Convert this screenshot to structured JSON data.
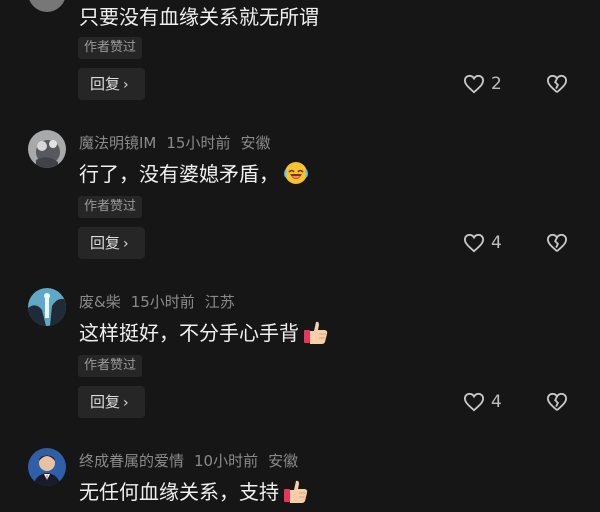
{
  "comments": [
    {
      "text": "只要没有血缘关系就无所谓",
      "author_liked": "作者赞过",
      "reply_label": "回复",
      "likes": "2"
    },
    {
      "username": "魔法明镜IM",
      "time": "15小时前",
      "location": "安徽",
      "text": "行了，没有婆媳矛盾，",
      "emoji": "laughing-face-emoji",
      "author_liked": "作者赞过",
      "reply_label": "回复",
      "likes": "4"
    },
    {
      "username": "废&柴",
      "time": "15小时前",
      "location": "江苏",
      "text": "这样挺好，不分手心手背",
      "emoji": "thumbs-up-emoji",
      "author_liked": "作者赞过",
      "reply_label": "回复",
      "likes": "4"
    },
    {
      "username": "终成眷属的爱情",
      "time": "10小时前",
      "location": "安徽",
      "text": "无任何血缘关系，支持",
      "emoji": "thumbs-up-emoji"
    }
  ]
}
